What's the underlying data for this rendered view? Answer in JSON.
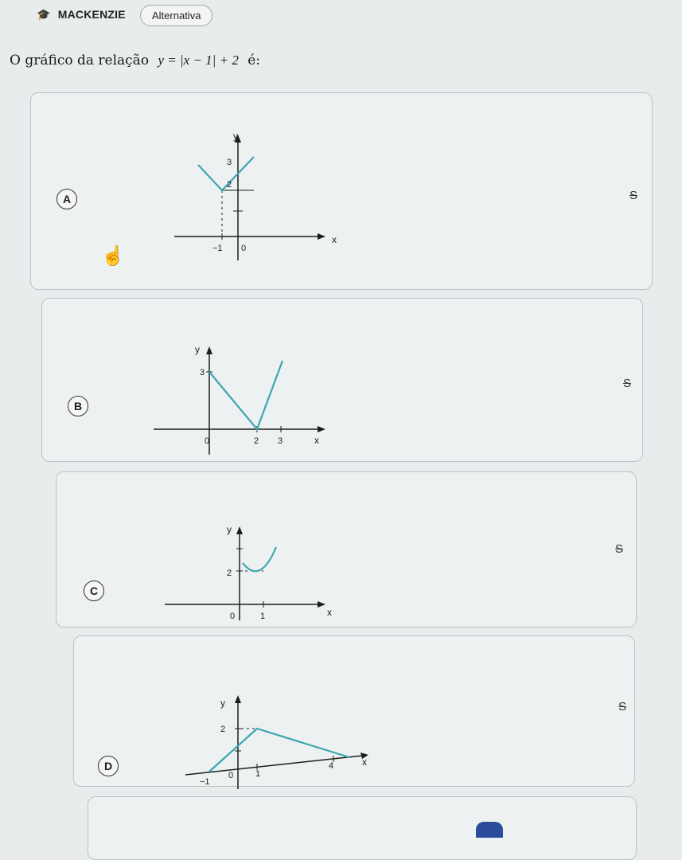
{
  "header": {
    "brand": "MACKENZIE",
    "tag": "Alternativa"
  },
  "question": {
    "prefix": "O gráfico da relação",
    "equation": "y = |x − 1| + 2",
    "suffix": "é:"
  },
  "options": [
    {
      "letter": "A",
      "strike": "S",
      "labels": {
        "y": "y",
        "x": "x",
        "t3": "3",
        "t2": "2",
        "tm1": "−1",
        "t0": "0"
      }
    },
    {
      "letter": "B",
      "strike": "S",
      "labels": {
        "y": "y",
        "x": "x",
        "t3": "3",
        "t0": "0",
        "t2": "2",
        "tx3": "3"
      }
    },
    {
      "letter": "C",
      "strike": "S",
      "labels": {
        "y": "y",
        "x": "x",
        "t2": "2",
        "t0": "0",
        "t1": "1"
      }
    },
    {
      "letter": "D",
      "strike": "S",
      "labels": {
        "y": "y",
        "x": "x",
        "t2": "2",
        "tm1": "−1",
        "t0": "0",
        "t1": "1",
        "t4": "4"
      }
    }
  ],
  "colors": {
    "curve": "#3aa7b0",
    "axis": "#1d1d1d",
    "border": "#b6c4c4"
  },
  "icons": {
    "brand": "graduation-cap-icon",
    "cursor": "hand-pointer-icon"
  }
}
